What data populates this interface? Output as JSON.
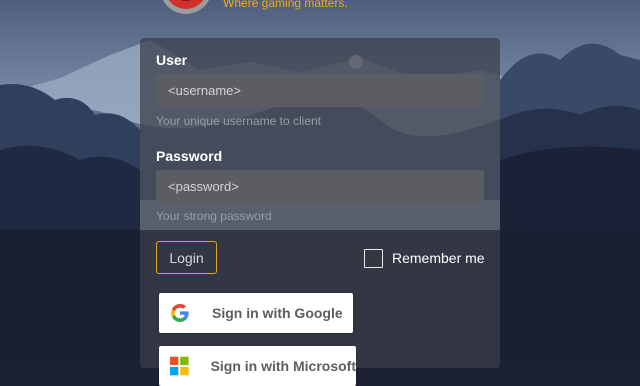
{
  "brand": {
    "tagline": "Where gaming matters.",
    "logo_icon": "red-ring-logo-icon"
  },
  "form": {
    "user_label": "User",
    "user_placeholder": "<username>",
    "user_hint": "Your unique username to client",
    "password_label": "Password",
    "password_placeholder": "<password>",
    "password_hint": "Your strong password",
    "login_label": "Login",
    "remember_label": "Remember me",
    "remember_checked": false
  },
  "social": {
    "google_label": "Sign in with Google",
    "google_icon": "google-g-icon",
    "microsoft_label": "Sign in with Microsoft",
    "microsoft_icon": "microsoft-icon"
  },
  "colors": {
    "accent": "#f0a91c",
    "panel": "#3c404a",
    "input": "#5b5d62"
  }
}
